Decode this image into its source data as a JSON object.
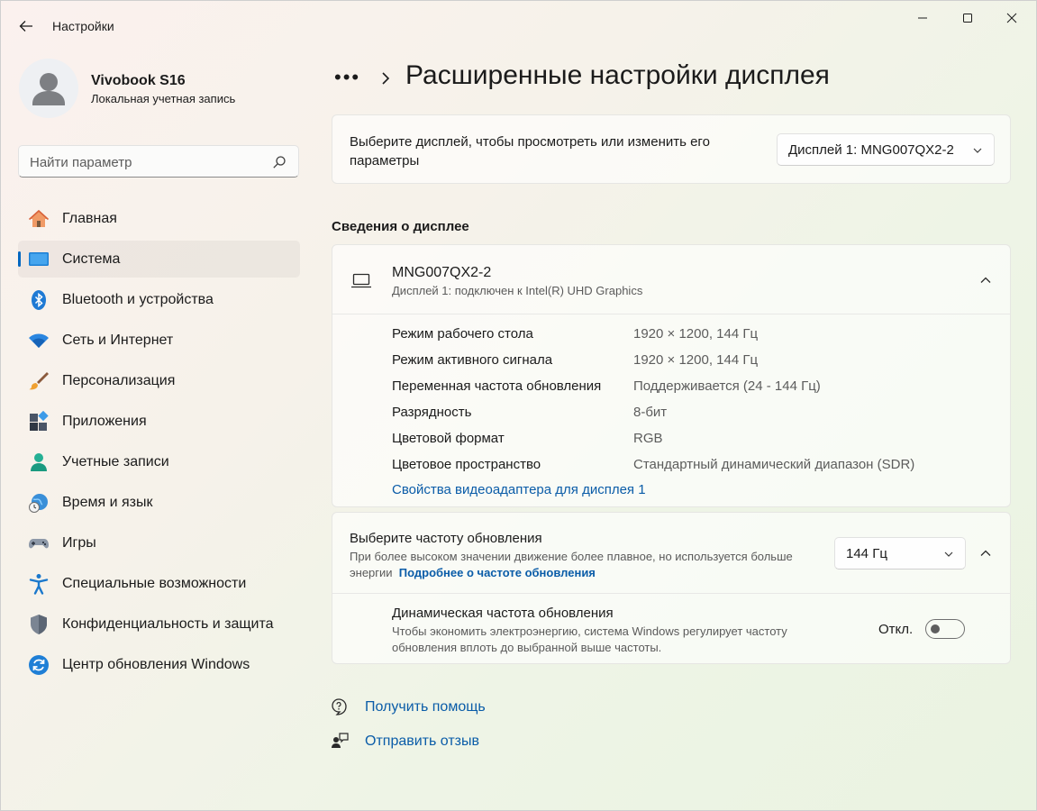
{
  "window": {
    "title": "Настройки"
  },
  "profile": {
    "name": "Vivobook S16",
    "account_type": "Локальная учетная запись"
  },
  "search": {
    "placeholder": "Найти параметр"
  },
  "sidebar": {
    "items": [
      {
        "label": "Главная",
        "icon": "home-icon",
        "active": false
      },
      {
        "label": "Система",
        "icon": "system-icon",
        "active": true
      },
      {
        "label": "Bluetooth и устройства",
        "icon": "bluetooth-icon",
        "active": false
      },
      {
        "label": "Сеть и Интернет",
        "icon": "wifi-icon",
        "active": false
      },
      {
        "label": "Персонализация",
        "icon": "brush-icon",
        "active": false
      },
      {
        "label": "Приложения",
        "icon": "apps-icon",
        "active": false
      },
      {
        "label": "Учетные записи",
        "icon": "accounts-icon",
        "active": false
      },
      {
        "label": "Время и язык",
        "icon": "time-language-icon",
        "active": false
      },
      {
        "label": "Игры",
        "icon": "gamepad-icon",
        "active": false
      },
      {
        "label": "Специальные возможности",
        "icon": "accessibility-icon",
        "active": false
      },
      {
        "label": "Конфиденциальность и защита",
        "icon": "shield-icon",
        "active": false
      },
      {
        "label": "Центр обновления Windows",
        "icon": "windows-update-icon",
        "active": false
      }
    ]
  },
  "main": {
    "breadcrumb_dots": "•••",
    "page_title": "Расширенные настройки дисплея",
    "display_select": {
      "label": "Выберите дисплей, чтобы просмотреть или изменить его параметры",
      "selected": "Дисплей 1: MNG007QX2-2"
    },
    "info_section": {
      "heading": "Сведения о дисплее",
      "device_name": "MNG007QX2-2",
      "device_sub": "Дисплей 1: подключен к Intel(R) UHD Graphics",
      "rows": [
        {
          "key": "Режим рабочего стола",
          "value": "1920 × 1200, 144 Гц"
        },
        {
          "key": "Режим активного сигнала",
          "value": "1920 × 1200, 144 Гц"
        },
        {
          "key": "Переменная частота обновления",
          "value": "Поддерживается (24 - 144 Гц)"
        },
        {
          "key": "Разрядность",
          "value": "8-бит"
        },
        {
          "key": "Цветовой формат",
          "value": "RGB"
        },
        {
          "key": "Цветовое пространство",
          "value": "Стандартный динамический диапазон (SDR)"
        }
      ],
      "adapter_link": "Свойства видеоадаптера для дисплея 1"
    },
    "refresh_rate": {
      "title": "Выберите частоту обновления",
      "description": "При более высоком значении движение более плавное, но используется больше энергии",
      "link": "Подробнее о частоте обновления",
      "selected": "144 Гц"
    },
    "dynamic_refresh": {
      "title": "Динамическая частота обновления",
      "description": "Чтобы экономить электроэнергию, система Windows регулирует частоту обновления вплоть до выбранной выше частоты.",
      "toggle_label": "Откл.",
      "enabled": false
    },
    "help": {
      "get_help": "Получить помощь",
      "feedback": "Отправить отзыв"
    }
  },
  "colors": {
    "accent": "#0067c0",
    "link": "#0a5ca8"
  }
}
